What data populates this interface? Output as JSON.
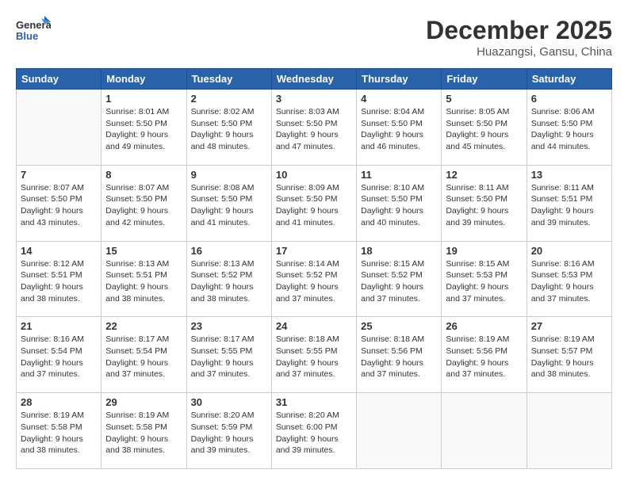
{
  "header": {
    "logo_general": "General",
    "logo_blue": "Blue",
    "month_title": "December 2025",
    "location": "Huazangsi, Gansu, China"
  },
  "calendar": {
    "days_of_week": [
      "Sunday",
      "Monday",
      "Tuesday",
      "Wednesday",
      "Thursday",
      "Friday",
      "Saturday"
    ],
    "weeks": [
      [
        {
          "day": "",
          "info": ""
        },
        {
          "day": "1",
          "info": "Sunrise: 8:01 AM\nSunset: 5:50 PM\nDaylight: 9 hours\nand 49 minutes."
        },
        {
          "day": "2",
          "info": "Sunrise: 8:02 AM\nSunset: 5:50 PM\nDaylight: 9 hours\nand 48 minutes."
        },
        {
          "day": "3",
          "info": "Sunrise: 8:03 AM\nSunset: 5:50 PM\nDaylight: 9 hours\nand 47 minutes."
        },
        {
          "day": "4",
          "info": "Sunrise: 8:04 AM\nSunset: 5:50 PM\nDaylight: 9 hours\nand 46 minutes."
        },
        {
          "day": "5",
          "info": "Sunrise: 8:05 AM\nSunset: 5:50 PM\nDaylight: 9 hours\nand 45 minutes."
        },
        {
          "day": "6",
          "info": "Sunrise: 8:06 AM\nSunset: 5:50 PM\nDaylight: 9 hours\nand 44 minutes."
        }
      ],
      [
        {
          "day": "7",
          "info": "Sunrise: 8:07 AM\nSunset: 5:50 PM\nDaylight: 9 hours\nand 43 minutes."
        },
        {
          "day": "8",
          "info": "Sunrise: 8:07 AM\nSunset: 5:50 PM\nDaylight: 9 hours\nand 42 minutes."
        },
        {
          "day": "9",
          "info": "Sunrise: 8:08 AM\nSunset: 5:50 PM\nDaylight: 9 hours\nand 41 minutes."
        },
        {
          "day": "10",
          "info": "Sunrise: 8:09 AM\nSunset: 5:50 PM\nDaylight: 9 hours\nand 41 minutes."
        },
        {
          "day": "11",
          "info": "Sunrise: 8:10 AM\nSunset: 5:50 PM\nDaylight: 9 hours\nand 40 minutes."
        },
        {
          "day": "12",
          "info": "Sunrise: 8:11 AM\nSunset: 5:50 PM\nDaylight: 9 hours\nand 39 minutes."
        },
        {
          "day": "13",
          "info": "Sunrise: 8:11 AM\nSunset: 5:51 PM\nDaylight: 9 hours\nand 39 minutes."
        }
      ],
      [
        {
          "day": "14",
          "info": "Sunrise: 8:12 AM\nSunset: 5:51 PM\nDaylight: 9 hours\nand 38 minutes."
        },
        {
          "day": "15",
          "info": "Sunrise: 8:13 AM\nSunset: 5:51 PM\nDaylight: 9 hours\nand 38 minutes."
        },
        {
          "day": "16",
          "info": "Sunrise: 8:13 AM\nSunset: 5:52 PM\nDaylight: 9 hours\nand 38 minutes."
        },
        {
          "day": "17",
          "info": "Sunrise: 8:14 AM\nSunset: 5:52 PM\nDaylight: 9 hours\nand 37 minutes."
        },
        {
          "day": "18",
          "info": "Sunrise: 8:15 AM\nSunset: 5:52 PM\nDaylight: 9 hours\nand 37 minutes."
        },
        {
          "day": "19",
          "info": "Sunrise: 8:15 AM\nSunset: 5:53 PM\nDaylight: 9 hours\nand 37 minutes."
        },
        {
          "day": "20",
          "info": "Sunrise: 8:16 AM\nSunset: 5:53 PM\nDaylight: 9 hours\nand 37 minutes."
        }
      ],
      [
        {
          "day": "21",
          "info": "Sunrise: 8:16 AM\nSunset: 5:54 PM\nDaylight: 9 hours\nand 37 minutes."
        },
        {
          "day": "22",
          "info": "Sunrise: 8:17 AM\nSunset: 5:54 PM\nDaylight: 9 hours\nand 37 minutes."
        },
        {
          "day": "23",
          "info": "Sunrise: 8:17 AM\nSunset: 5:55 PM\nDaylight: 9 hours\nand 37 minutes."
        },
        {
          "day": "24",
          "info": "Sunrise: 8:18 AM\nSunset: 5:55 PM\nDaylight: 9 hours\nand 37 minutes."
        },
        {
          "day": "25",
          "info": "Sunrise: 8:18 AM\nSunset: 5:56 PM\nDaylight: 9 hours\nand 37 minutes."
        },
        {
          "day": "26",
          "info": "Sunrise: 8:19 AM\nSunset: 5:56 PM\nDaylight: 9 hours\nand 37 minutes."
        },
        {
          "day": "27",
          "info": "Sunrise: 8:19 AM\nSunset: 5:57 PM\nDaylight: 9 hours\nand 38 minutes."
        }
      ],
      [
        {
          "day": "28",
          "info": "Sunrise: 8:19 AM\nSunset: 5:58 PM\nDaylight: 9 hours\nand 38 minutes."
        },
        {
          "day": "29",
          "info": "Sunrise: 8:19 AM\nSunset: 5:58 PM\nDaylight: 9 hours\nand 38 minutes."
        },
        {
          "day": "30",
          "info": "Sunrise: 8:20 AM\nSunset: 5:59 PM\nDaylight: 9 hours\nand 39 minutes."
        },
        {
          "day": "31",
          "info": "Sunrise: 8:20 AM\nSunset: 6:00 PM\nDaylight: 9 hours\nand 39 minutes."
        },
        {
          "day": "",
          "info": ""
        },
        {
          "day": "",
          "info": ""
        },
        {
          "day": "",
          "info": ""
        }
      ]
    ]
  }
}
